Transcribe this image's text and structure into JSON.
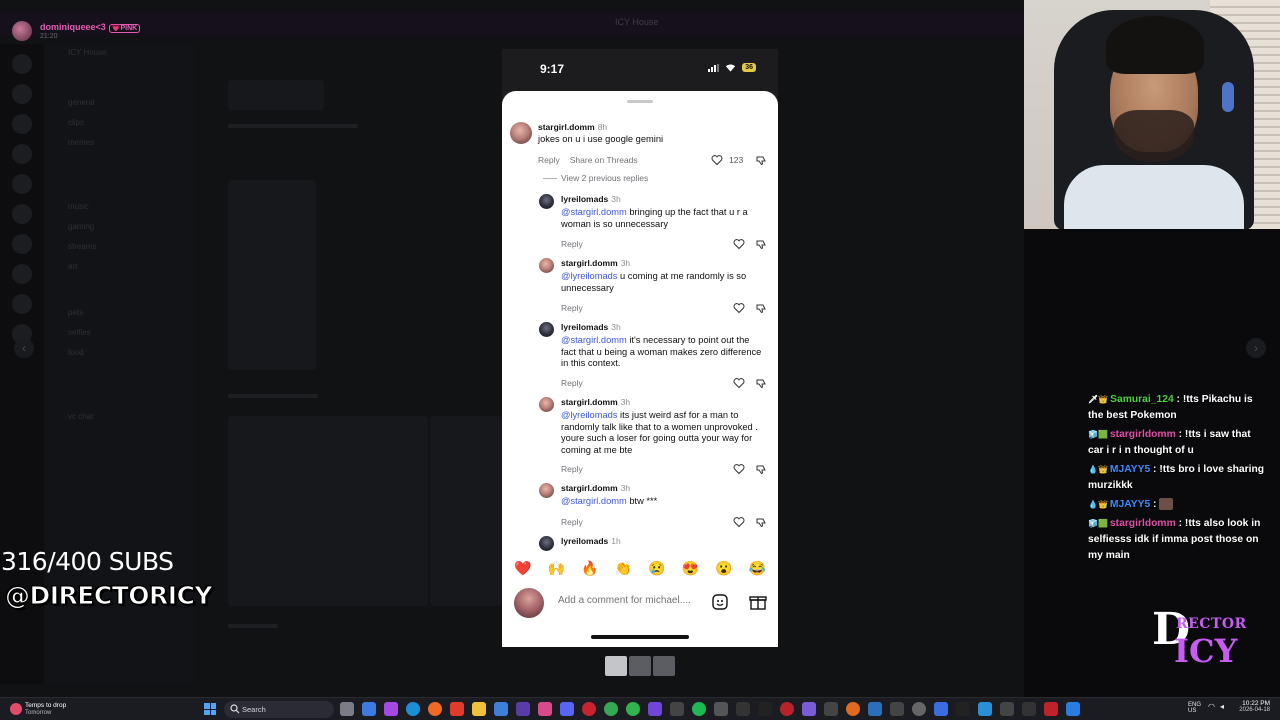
{
  "discord": {
    "streamer_name": "dominiqueee<3",
    "streamer_badge": "💗PINK",
    "streamer_sub": "21:20",
    "window_title": "ICY House",
    "channels": [
      "ICY House",
      "general",
      "clips",
      "memes",
      "music",
      "gaming",
      "streams",
      "art",
      "pets",
      "selfies",
      "food",
      "vc chat"
    ]
  },
  "overlay": {
    "subs": "316/400 SUBS",
    "handle": "@DIRECTORICY"
  },
  "phone": {
    "time": "9:17",
    "battery": "36",
    "comments": [
      {
        "user": "stargirl.domm",
        "time": "8h",
        "mention": "",
        "text": "jokes on u i use google gemini",
        "reply": "Reply",
        "share": "Share on Threads",
        "likes": "123"
      },
      {
        "user": "lyreilomads",
        "time": "3h",
        "mention": "@stargirl.domm",
        "text": " bringing up the fact that u r a woman is so unnecessary",
        "reply": "Reply"
      },
      {
        "user": "stargirl.domm",
        "time": "3h",
        "mention": "@lyreilomads",
        "text": " u coming at me randomly is so unnecessary",
        "reply": "Reply"
      },
      {
        "user": "lyreilomads",
        "time": "3h",
        "mention": "@stargirl.domm",
        "text": " it's necessary to point out the fact that u being a woman makes zero difference in this context.",
        "reply": "Reply"
      },
      {
        "user": "stargirl.domm",
        "time": "3h",
        "mention": "@lyreilomads",
        "text": " its just weird asf for a man to randomly talk like that to a women unprovoked . youre such a loser for going outta your way for coming at me bte",
        "reply": "Reply"
      },
      {
        "user": "stargirl.domm",
        "time": "3h",
        "mention": "@stargirl.domm",
        "text": " btw ***",
        "reply": "Reply"
      },
      {
        "user": "lyreilomads",
        "time": "1h",
        "mention": "",
        "text": "",
        "reply": ""
      }
    ],
    "view_replies": "View 2 previous replies",
    "emojis": [
      "❤️",
      "🙌",
      "🔥",
      "👏",
      "😢",
      "😍",
      "😮",
      "😂"
    ],
    "comment_placeholder": "Add a comment for michael...."
  },
  "chat": [
    {
      "badges": "🗡👑",
      "user": "Samurai_124",
      "color": "#4fd142",
      "text": "!tts Pikachu is the best Pokemon"
    },
    {
      "badges": "🧊🟩",
      "user": "stargirldomm",
      "color": "#e24fa8",
      "text": "!tts i saw that car i r i n thought of u"
    },
    {
      "badges": "💧👑",
      "user": "MJAYY5",
      "color": "#3a8cff",
      "text": "!tts bro i love sharing murzikkk"
    },
    {
      "badges": "💧👑",
      "user": "MJAYY5",
      "color": "#3a8cff",
      "text": ""
    },
    {
      "badges": "🧊🟩",
      "user": "stargirldomm",
      "color": "#e24fa8",
      "text": "!tts also look in selfiesss idk if imma post those on my main"
    }
  ],
  "logo": {
    "d": "D",
    "rector": "RECTOR",
    "icy": "ICY"
  },
  "taskbar": {
    "weather_line1": "Temps to drop",
    "weather_line2": "Tomorrow",
    "search_label": "Search",
    "lang_1": "ENG",
    "lang_2": "US",
    "time": "10:22 PM",
    "date": "2026-04-18"
  }
}
